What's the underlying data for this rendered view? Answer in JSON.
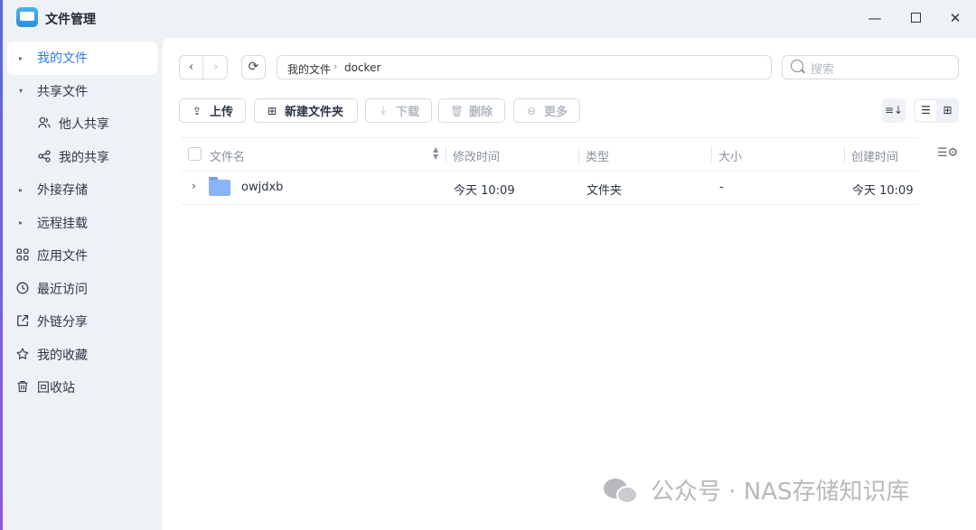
{
  "window": {
    "title": "文件管理",
    "minimize": "—",
    "close": "✕"
  },
  "sidebar": {
    "items": [
      {
        "label": "我的文件",
        "icon": "caret-right-icon",
        "active": true
      },
      {
        "label": "共享文件",
        "icon": "caret-down-icon"
      },
      {
        "label": "他人共享",
        "icon": "users-icon"
      },
      {
        "label": "我的共享",
        "icon": "share-icon"
      },
      {
        "label": "外接存储",
        "icon": "caret-right-icon"
      },
      {
        "label": "远程挂载",
        "icon": "caret-right-icon"
      },
      {
        "label": "应用文件",
        "icon": "apps-icon"
      },
      {
        "label": "最近访问",
        "icon": "clock-icon"
      },
      {
        "label": "外链分享",
        "icon": "external-share-icon"
      },
      {
        "label": "我的收藏",
        "icon": "star-icon"
      },
      {
        "label": "回收站",
        "icon": "trash-icon"
      }
    ]
  },
  "toolbar": {
    "path": [
      "我的文件",
      "docker"
    ],
    "search_placeholder": "搜索",
    "upload": "上传",
    "new_folder": "新建文件夹",
    "download": "下载",
    "delete": "删除",
    "more": "更多"
  },
  "table": {
    "columns": [
      "文件名",
      "修改时间",
      "类型",
      "大小",
      "创建时间"
    ],
    "rows": [
      {
        "name": "owjdxb",
        "modified": "今天 10:09",
        "type": "文件夹",
        "size": "-",
        "created": "今天 10:09"
      }
    ]
  },
  "watermark": {
    "text": "公众号 · NAS存储知识库"
  },
  "colors": {
    "accent": "#2f7de8",
    "sidebar_bg": "#eef1f6",
    "folder": "#8ab4f8"
  }
}
